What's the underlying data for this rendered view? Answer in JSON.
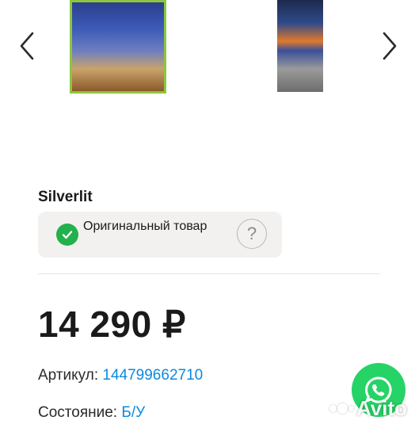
{
  "brand": "Silverlit",
  "original_badge": {
    "label": "Оригинальный товар",
    "status_icon": "check-circle-icon",
    "help_icon": "question-icon",
    "help_glyph": "?"
  },
  "price": "14 290 ₽",
  "details": {
    "article_label": "Артикул:",
    "article_value": "144799662710",
    "condition_label": "Состояние:",
    "condition_value": "Б/У"
  },
  "watermark": "Avito",
  "colors": {
    "accent_green": "#22b14c",
    "link_blue": "#0a8ae0",
    "whatsapp_green": "#25d366",
    "selected_thumb_border": "#8cc63f"
  }
}
